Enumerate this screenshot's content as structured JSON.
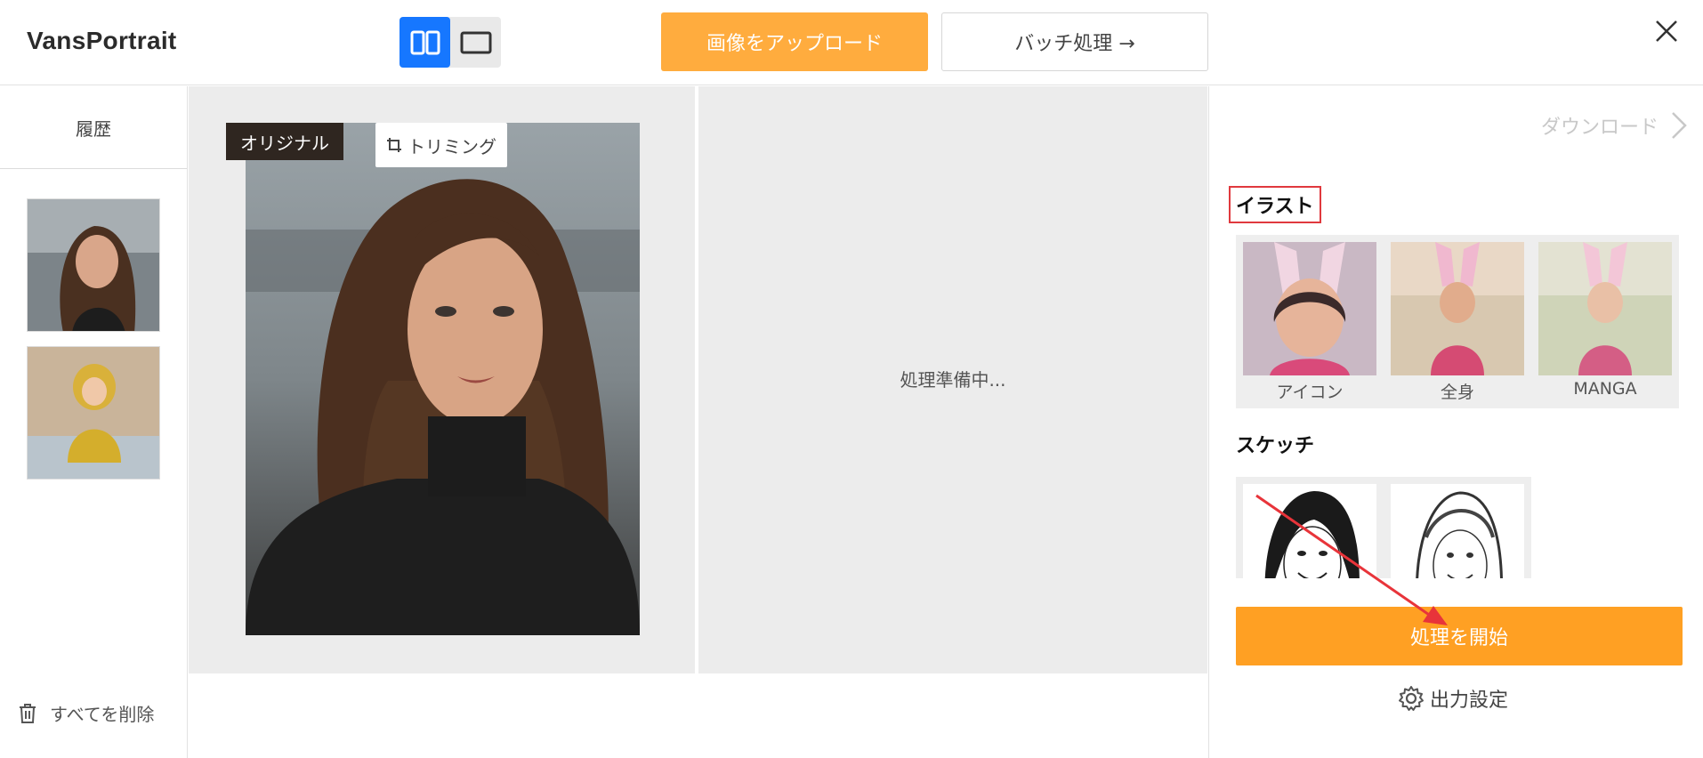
{
  "app": {
    "title": "VansPortrait"
  },
  "toolbar": {
    "view_modes": [
      "split-view-icon",
      "single-view-icon"
    ],
    "active_view": "split",
    "upload_label": "画像をアップロード",
    "batch_label": "バッチ処理 →",
    "close_icon": "close-icon"
  },
  "sidebar": {
    "history_label": "履歴",
    "thumbnails": [
      {
        "icon": "portrait-woman-thumbnail"
      },
      {
        "icon": "child-yellow-hoodie-thumbnail"
      }
    ],
    "delete_all_label": "すべてを削除"
  },
  "canvas": {
    "original_badge": "オリジナル",
    "trim_label": "トリミング",
    "processing_text": "処理準備中..."
  },
  "panel": {
    "download_label": "ダウンロード",
    "illust": {
      "title": "イラスト",
      "items": [
        {
          "label": "アイコン"
        },
        {
          "label": "全身"
        },
        {
          "label": "MANGA"
        }
      ]
    },
    "sketch": {
      "title": "スケッチ"
    },
    "start_label": "処理を開始",
    "output_settings_label": "出力設定"
  },
  "colors": {
    "accent_upload": "#ffac3e",
    "accent_start": "#ffa023",
    "active_toggle": "#1677ff",
    "highlight_box": "#e0393e"
  }
}
